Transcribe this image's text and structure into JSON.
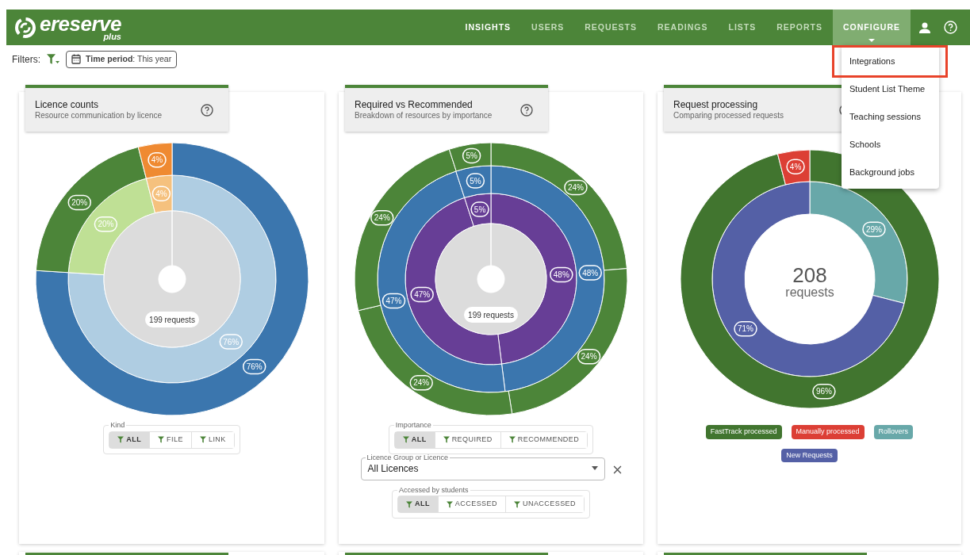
{
  "header": {
    "logo": {
      "name": "ereserve",
      "suffix": "plus"
    },
    "nav": [
      {
        "label": "INSIGHTS",
        "selected": true,
        "expanded": false
      },
      {
        "label": "USERS",
        "selected": false,
        "expanded": false
      },
      {
        "label": "REQUESTS",
        "selected": false,
        "expanded": false
      },
      {
        "label": "READINGS",
        "selected": false,
        "expanded": false
      },
      {
        "label": "LISTS",
        "selected": false,
        "expanded": false
      },
      {
        "label": "REPORTS",
        "selected": false,
        "expanded": false
      },
      {
        "label": "CONFIGURE",
        "selected": false,
        "expanded": true
      }
    ],
    "menu": [
      {
        "label": "Integrations",
        "outlined": true
      },
      {
        "label": "Student List Theme",
        "outlined": false
      },
      {
        "label": "Teaching sessions",
        "outlined": false
      },
      {
        "label": "Schools",
        "outlined": false
      },
      {
        "label": "Background jobs",
        "outlined": false
      }
    ]
  },
  "filters": {
    "label": "Filters:",
    "time_period": {
      "label": "Time period",
      "value": ": This year"
    }
  },
  "panels": [
    {
      "title": "Licence counts",
      "subtitle": "Resource communication by licence",
      "center_label": "199 requests",
      "chart_data": {
        "type": "donut",
        "series": [
          {
            "colors": [
              "#afcde2",
              "#bfe095",
              "#f5c17e"
            ],
            "values": [
              76,
              20,
              4
            ]
          },
          {
            "colors": [
              "#3b76ae",
              "#4c8539",
              "#ef8a32"
            ],
            "values": [
              76,
              20,
              4
            ]
          }
        ],
        "value_labels": [
          [
            "76%",
            "20%",
            "4%"
          ],
          [
            "76%",
            "20%",
            "4%"
          ]
        ]
      },
      "toggles": [
        {
          "legend": "Kind",
          "options": [
            {
              "label": "ALL",
              "selected": true
            },
            {
              "label": "FILE",
              "selected": false
            },
            {
              "label": "LINK",
              "selected": false
            }
          ]
        }
      ]
    },
    {
      "title": "Required vs Recommended",
      "subtitle": "Breakdown of resources by importance",
      "center_label": "199 requests",
      "chart_data": {
        "type": "donut",
        "series": [
          {
            "colors": [
              "#673e96",
              "#673e96",
              "#673e96"
            ],
            "values": [
              48,
              47,
              5
            ]
          },
          {
            "colors": [
              "#3b76ae",
              "#3b76ae",
              "#3b76ae"
            ],
            "values": [
              48,
              47,
              5
            ]
          },
          {
            "colors": [
              "#4c8539",
              "#4c8539",
              "#4c8539",
              "#4c8539",
              "#4c8539"
            ],
            "values": [
              24,
              24,
              24,
              24,
              5
            ]
          }
        ],
        "value_labels": [
          [
            "48%",
            "47%",
            "5%"
          ],
          [
            "48%",
            "47%",
            "5%"
          ],
          [
            "24%",
            "24%",
            "24%",
            "24%",
            "5%"
          ]
        ]
      },
      "toggles": [
        {
          "legend": "Importance",
          "options": [
            {
              "label": "ALL",
              "selected": true
            },
            {
              "label": "REQUIRED",
              "selected": false
            },
            {
              "label": "RECOMMENDED",
              "selected": false
            }
          ]
        },
        {
          "legend": "Accessed by students",
          "options": [
            {
              "label": "ALL",
              "selected": true
            },
            {
              "label": "ACCESSED",
              "selected": false
            },
            {
              "label": "UNACCESSED",
              "selected": false
            }
          ]
        }
      ],
      "select": {
        "label": "Licence Group or Licence",
        "value": "All Licences"
      }
    },
    {
      "title": "Request processing",
      "subtitle": "Comparing processed requests",
      "center_value": "208",
      "center_unit": "requests",
      "chart_data": {
        "type": "donut",
        "series": [
          {
            "colors": [
              "#68a8a9",
              "#5460a6"
            ],
            "values": [
              29,
              71
            ]
          },
          {
            "colors": [
              "#41752f",
              "#dc3f35"
            ],
            "values": [
              96,
              4
            ]
          }
        ],
        "value_labels": [
          [
            "29%",
            "71%"
          ],
          [
            "96%",
            "4%"
          ]
        ]
      },
      "legend": [
        {
          "label": "FastTrack processed",
          "color": "#41752f"
        },
        {
          "label": "Manually processed",
          "color": "#dc3f35"
        },
        {
          "label": "Rollovers",
          "color": "#68a8a9"
        },
        {
          "label": "New Requests",
          "color": "#5460a6"
        }
      ]
    }
  ]
}
